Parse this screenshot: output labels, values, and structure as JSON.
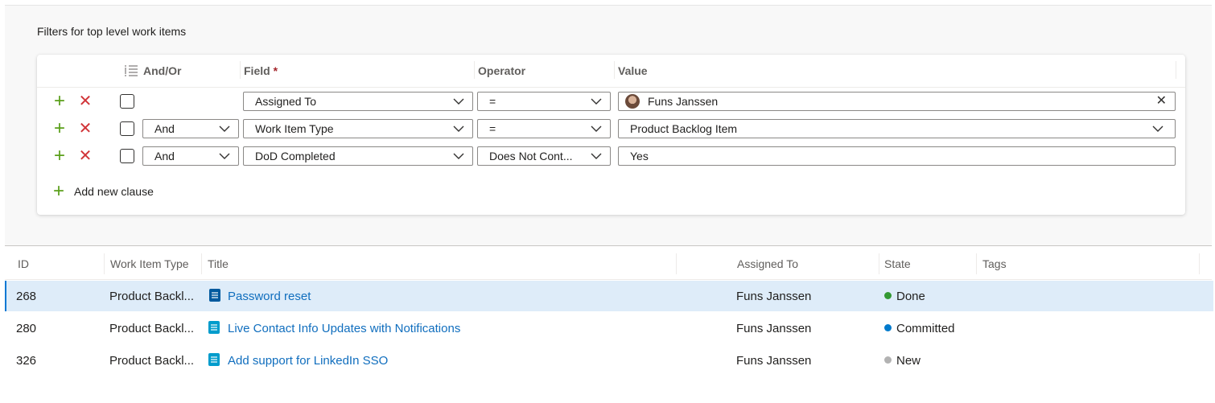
{
  "filters": {
    "title": "Filters for top level work items",
    "headers": {
      "and_or": "And/Or",
      "field": "Field",
      "required_mark": "*",
      "operator": "Operator",
      "value": "Value"
    },
    "clauses": [
      {
        "and_or": "",
        "field": "Assigned To",
        "operator": "=",
        "value": "Funs Janssen",
        "value_type": "identity"
      },
      {
        "and_or": "And",
        "field": "Work Item Type",
        "operator": "=",
        "value": "Product Backlog Item",
        "value_type": "dropdown"
      },
      {
        "and_or": "And",
        "field": "DoD Completed",
        "operator": "Does Not Cont...",
        "value": "Yes",
        "value_type": "text"
      }
    ],
    "add_clause_label": "Add new clause"
  },
  "results": {
    "columns": {
      "id": "ID",
      "type": "Work Item Type",
      "title": "Title",
      "assigned": "Assigned To",
      "state": "State",
      "tags": "Tags"
    },
    "rows": [
      {
        "id": "268",
        "type": "Product Backl...",
        "title": "Password reset",
        "assigned": "Funs Janssen",
        "state": "Done",
        "state_color": "#339933",
        "selected": true
      },
      {
        "id": "280",
        "type": "Product Backl...",
        "title": "Live Contact Info Updates with Notifications",
        "assigned": "Funs Janssen",
        "state": "Committed",
        "state_color": "#007acc",
        "selected": false
      },
      {
        "id": "326",
        "type": "Product Backl...",
        "title": "Add support for LinkedIn SSO",
        "assigned": "Funs Janssen",
        "state": "New",
        "state_color": "#b2b2b2",
        "selected": false
      }
    ]
  },
  "colors": {
    "accent": "#0078d4",
    "add": "#5a9f1a",
    "remove": "#d13438",
    "pbi_icon": "#009ccc",
    "pbi_icon_selected": "#005a9e"
  }
}
